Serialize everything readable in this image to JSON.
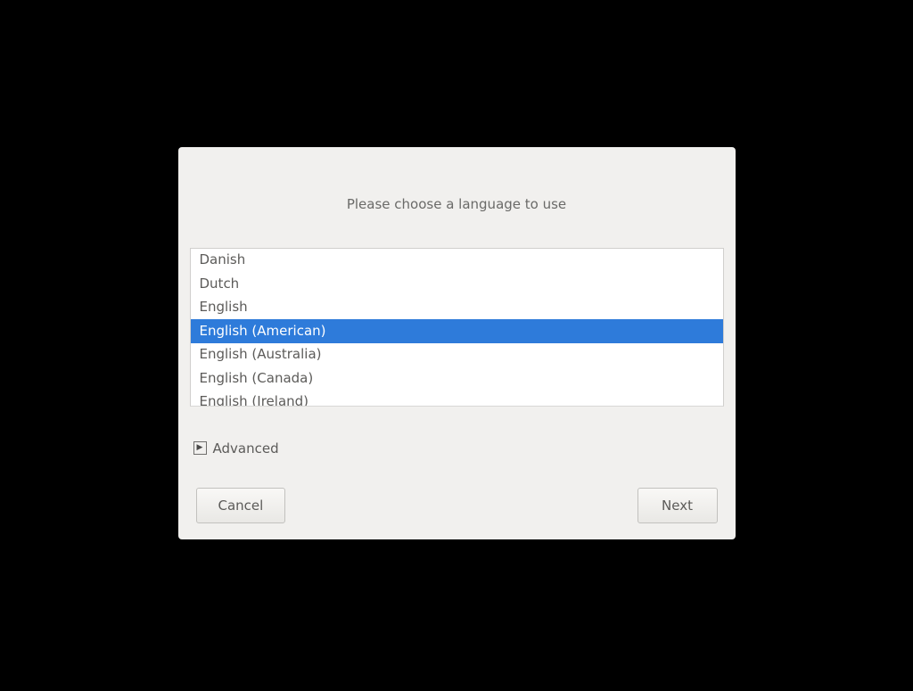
{
  "dialog": {
    "title": "Please choose a language to use",
    "languages": [
      "Danish",
      "Dutch",
      "English",
      "English (American)",
      "English (Australia)",
      "English (Canada)",
      "English (Ireland)"
    ],
    "selectedIndex": 3,
    "advanced": {
      "label": "Advanced"
    },
    "buttons": {
      "cancel": "Cancel",
      "next": "Next"
    }
  },
  "colors": {
    "selected_bg": "#2e7bda"
  }
}
